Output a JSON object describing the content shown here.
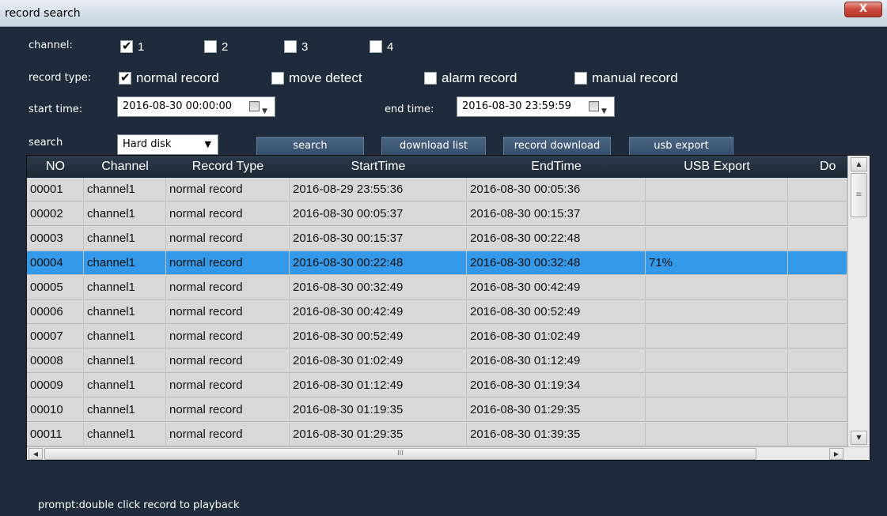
{
  "window": {
    "title": "record search",
    "close_label": "X"
  },
  "filters": {
    "channel_label": "channel:",
    "channels": [
      {
        "label": "1",
        "checked": true
      },
      {
        "label": "2",
        "checked": false
      },
      {
        "label": "3",
        "checked": false
      },
      {
        "label": "4",
        "checked": false
      }
    ],
    "record_type_label": "record type:",
    "record_types": [
      {
        "label": "normal record",
        "checked": true
      },
      {
        "label": "move detect",
        "checked": false
      },
      {
        "label": "alarm record",
        "checked": false
      },
      {
        "label": "manual record",
        "checked": false
      }
    ],
    "start_time_label": "start time:",
    "start_time_value": "2016-08-30 00:00:00",
    "end_time_label": "end time:",
    "end_time_value": "2016-08-30 23:59:59",
    "search_label": "search",
    "search_source": "Hard disk"
  },
  "buttons": {
    "search": "search",
    "download_list": "download list",
    "record_download": "record download",
    "usb_export": "usb export"
  },
  "table": {
    "columns": [
      "NO",
      "Channel",
      "Record Type",
      "StartTime",
      "EndTime",
      "USB Export",
      "Do"
    ],
    "rows": [
      [
        "00001",
        "channel1",
        "normal record",
        "2016-08-29 23:55:36",
        "2016-08-30 00:05:36",
        "",
        ""
      ],
      [
        "00002",
        "channel1",
        "normal record",
        "2016-08-30 00:05:37",
        "2016-08-30 00:15:37",
        "",
        ""
      ],
      [
        "00003",
        "channel1",
        "normal record",
        "2016-08-30 00:15:37",
        "2016-08-30 00:22:48",
        "",
        ""
      ],
      [
        "00004",
        "channel1",
        "normal record",
        "2016-08-30 00:22:48",
        "2016-08-30 00:32:48",
        "71%",
        ""
      ],
      [
        "00005",
        "channel1",
        "normal record",
        "2016-08-30 00:32:49",
        "2016-08-30 00:42:49",
        "",
        ""
      ],
      [
        "00006",
        "channel1",
        "normal record",
        "2016-08-30 00:42:49",
        "2016-08-30 00:52:49",
        "",
        ""
      ],
      [
        "00007",
        "channel1",
        "normal record",
        "2016-08-30 00:52:49",
        "2016-08-30 01:02:49",
        "",
        ""
      ],
      [
        "00008",
        "channel1",
        "normal record",
        "2016-08-30 01:02:49",
        "2016-08-30 01:12:49",
        "",
        ""
      ],
      [
        "00009",
        "channel1",
        "normal record",
        "2016-08-30 01:12:49",
        "2016-08-30 01:19:34",
        "",
        ""
      ],
      [
        "00010",
        "channel1",
        "normal record",
        "2016-08-30 01:19:35",
        "2016-08-30 01:29:35",
        "",
        ""
      ],
      [
        "00011",
        "channel1",
        "normal record",
        "2016-08-30 01:29:35",
        "2016-08-30 01:39:35",
        "",
        ""
      ]
    ],
    "selected_row": 3
  },
  "prompt": "prompt:double click record to playback",
  "colors": {
    "background": "#1f2b3a",
    "selection": "#3399e8",
    "grid": "#d8d8d8"
  }
}
